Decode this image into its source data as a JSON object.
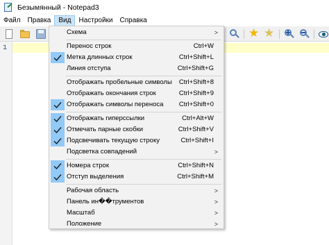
{
  "window": {
    "title": "Безымянный - Notepad3"
  },
  "menubar": [
    "Файл",
    "Правка",
    "Вид",
    "Настройки",
    "Справка"
  ],
  "active_menu_index": 2,
  "editor": {
    "line_numbers": [
      "1"
    ]
  },
  "view_menu": {
    "items": [
      {
        "label": "Схема",
        "shortcut": "",
        "checked": false,
        "submenu": true
      },
      {
        "label": "Перенос строк",
        "shortcut": "Ctrl+W",
        "checked": false,
        "submenu": false
      },
      {
        "label": "Метка длинных строк",
        "shortcut": "Ctrl+Shift+L",
        "checked": true,
        "submenu": false
      },
      {
        "label": "Линия отступа",
        "shortcut": "Ctrl+Shift+G",
        "checked": false,
        "submenu": false
      },
      {
        "label": "Отображать пробельные символы",
        "shortcut": "Ctrl+Shift+8",
        "checked": false,
        "submenu": false
      },
      {
        "label": "Отображать окончания строк",
        "shortcut": "Ctrl+Shift+9",
        "checked": false,
        "submenu": false
      },
      {
        "label": "Отображать символы переноса",
        "shortcut": "Ctrl+Shift+0",
        "checked": true,
        "submenu": false
      },
      {
        "label": "Отображать гиперссылки",
        "shortcut": "Ctrl+Alt+W",
        "checked": true,
        "submenu": false
      },
      {
        "label": "Отмечать парные скобки",
        "shortcut": "Ctrl+Shift+V",
        "checked": true,
        "submenu": false
      },
      {
        "label": "Подсвечивать текущую строку",
        "shortcut": "Ctrl+Shift+I",
        "checked": true,
        "submenu": false
      },
      {
        "label": "Подсветка совпадений",
        "shortcut": "",
        "checked": false,
        "submenu": true
      },
      {
        "label": "Номера строк",
        "shortcut": "Ctrl+Shift+N",
        "checked": true,
        "submenu": false
      },
      {
        "label": "Отступ выделения",
        "shortcut": "Ctrl+Shift+M",
        "checked": true,
        "submenu": false
      },
      {
        "label": "Рабочая область",
        "shortcut": "",
        "checked": false,
        "submenu": true
      },
      {
        "label": "Панель ин��трументов",
        "shortcut": "",
        "checked": false,
        "submenu": true
      },
      {
        "label": "Масштаб",
        "shortcut": "",
        "checked": false,
        "submenu": true
      },
      {
        "label": "Положение",
        "shortcut": "",
        "checked": false,
        "submenu": true
      }
    ]
  },
  "colors": {
    "accent_check": "#91c9f7",
    "active_menu": "#cce4f7",
    "current_line": "#ffffc8"
  }
}
